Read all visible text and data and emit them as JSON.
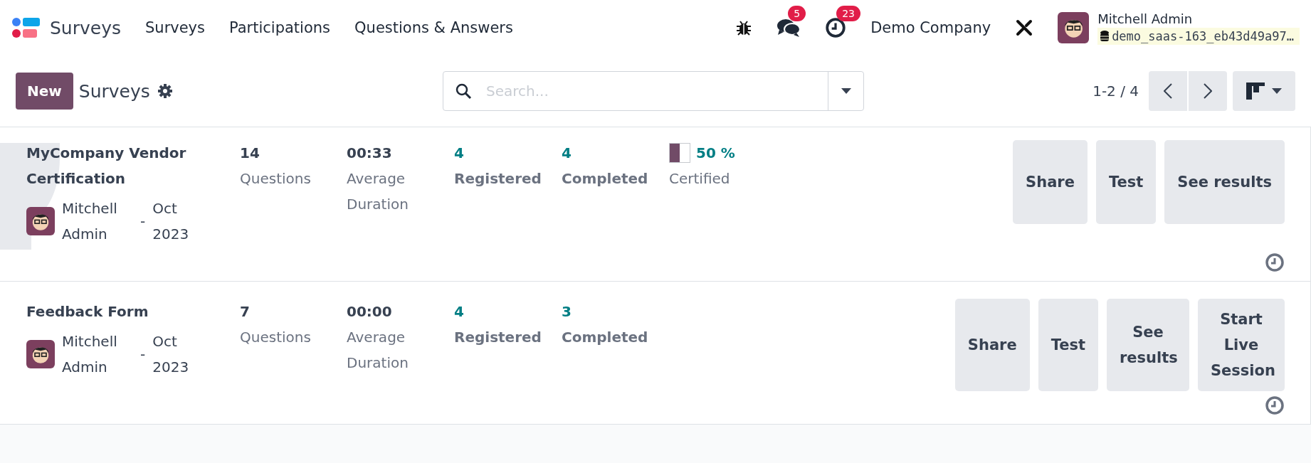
{
  "navbar": {
    "app_name": "Surveys",
    "menu": [
      "Surveys",
      "Participations",
      "Questions & Answers"
    ],
    "messages_count": "5",
    "activities_count": "23",
    "company": "Demo Company",
    "user_name": "Mitchell Admin",
    "database": "demo_saas-163_eb43d49a97…"
  },
  "control_panel": {
    "new_button": "New",
    "breadcrumb": "Surveys",
    "search": {
      "placeholder": "Search..."
    },
    "pager": "1-2 / 4"
  },
  "surveys": [
    {
      "title": "MyCompany Vendor Certification",
      "certification": true,
      "responsible": "Mitchell Admin",
      "separator": "-",
      "date": "Oct 2023",
      "stats": [
        {
          "value": "14",
          "label": "Questions",
          "kind": "plain"
        },
        {
          "value": "00:33",
          "label": "Average Duration",
          "kind": "plain"
        },
        {
          "value": "4",
          "label": "Registered",
          "kind": "link"
        },
        {
          "value": "4",
          "label": "Completed",
          "kind": "link"
        }
      ],
      "certified": {
        "level": 0.5,
        "value": "50 %",
        "label": "Certified"
      },
      "buttons": [
        "Share",
        "Test",
        "See results"
      ]
    },
    {
      "title": "Feedback Form",
      "certification": false,
      "responsible": "Mitchell Admin",
      "separator": "-",
      "date": "Oct 2023",
      "stats": [
        {
          "value": "7",
          "label": "Questions",
          "kind": "plain"
        },
        {
          "value": "00:00",
          "label": "Average Duration",
          "kind": "plain"
        },
        {
          "value": "4",
          "label": "Registered",
          "kind": "link"
        },
        {
          "value": "3",
          "label": "Completed",
          "kind": "link"
        }
      ],
      "buttons": [
        "Share",
        "Test",
        "See results",
        "Start Live Session"
      ]
    }
  ]
}
